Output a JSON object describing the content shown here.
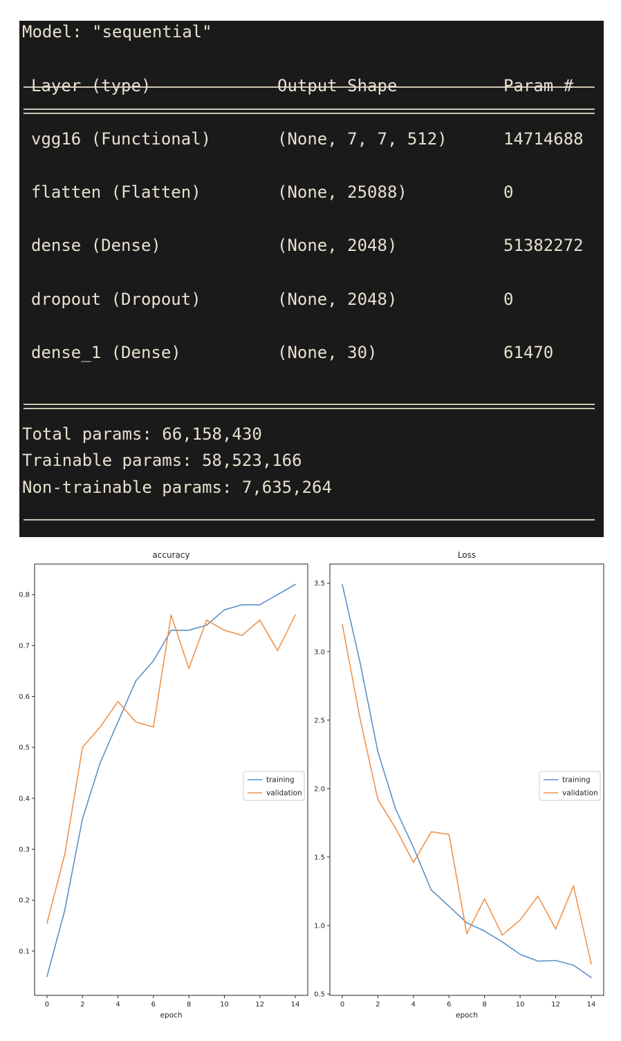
{
  "summary": {
    "model_line": "Model: \"sequential\"",
    "headers": [
      "Layer (type)",
      "Output Shape",
      "Param #"
    ],
    "rows": [
      {
        "layer": "vgg16 (Functional)",
        "shape": "(None, 7, 7, 512)",
        "params": "14714688"
      },
      {
        "layer": "flatten (Flatten)",
        "shape": "(None, 25088)",
        "params": "0"
      },
      {
        "layer": "dense (Dense)",
        "shape": "(None, 2048)",
        "params": "51382272"
      },
      {
        "layer": "dropout (Dropout)",
        "shape": "(None, 2048)",
        "params": "0"
      },
      {
        "layer": "dense_1 (Dense)",
        "shape": "(None, 30)",
        "params": "61470"
      }
    ],
    "total": "Total params: 66,158,430",
    "trainable": "Trainable params: 58,523,166",
    "non_trainable": "Non-trainable params: 7,635,264"
  },
  "chart_data": [
    {
      "type": "line",
      "title": "accuracy",
      "xlabel": "epoch",
      "ylabel": "",
      "x": [
        0,
        1,
        2,
        3,
        4,
        5,
        6,
        7,
        8,
        9,
        10,
        11,
        12,
        13,
        14
      ],
      "series": [
        {
          "name": "training",
          "color": "#5b8fc7",
          "values": [
            0.05,
            0.18,
            0.36,
            0.47,
            0.55,
            0.63,
            0.67,
            0.73,
            0.73,
            0.74,
            0.77,
            0.78,
            0.78,
            0.8,
            0.82
          ]
        },
        {
          "name": "validation",
          "color": "#f0924a",
          "values": [
            0.155,
            0.29,
            0.5,
            0.54,
            0.59,
            0.55,
            0.54,
            0.76,
            0.655,
            0.75,
            0.73,
            0.72,
            0.75,
            0.69,
            0.76
          ]
        }
      ],
      "xlim": [
        -0.7,
        14.7
      ],
      "ylim": [
        0.013,
        0.86
      ],
      "xticks": [
        0,
        2,
        4,
        6,
        8,
        10,
        12,
        14
      ],
      "yticks": [
        0.1,
        0.2,
        0.3,
        0.4,
        0.5,
        0.6,
        0.7,
        0.8
      ],
      "legend": "center-right"
    },
    {
      "type": "line",
      "title": "Loss",
      "xlabel": "epoch",
      "ylabel": "",
      "x": [
        0,
        1,
        2,
        3,
        4,
        5,
        6,
        7,
        8,
        9,
        10,
        11,
        12,
        13,
        14
      ],
      "series": [
        {
          "name": "training",
          "color": "#5b8fc7",
          "values": [
            3.49,
            2.92,
            2.27,
            1.85,
            1.57,
            1.26,
            1.14,
            1.02,
            0.96,
            0.88,
            0.79,
            0.74,
            0.745,
            0.71,
            0.62
          ]
        },
        {
          "name": "validation",
          "color": "#f0924a",
          "values": [
            3.2,
            2.51,
            1.92,
            1.71,
            1.46,
            1.685,
            1.665,
            0.94,
            1.195,
            0.93,
            1.04,
            1.215,
            0.975,
            1.29,
            0.72
          ]
        }
      ],
      "xlim": [
        -0.7,
        14.7
      ],
      "ylim": [
        0.49,
        3.64
      ],
      "xticks": [
        0,
        2,
        4,
        6,
        8,
        10,
        12,
        14
      ],
      "yticks": [
        0.5,
        1.0,
        1.5,
        2.0,
        2.5,
        3.0,
        3.5
      ],
      "legend": "center-right"
    }
  ]
}
